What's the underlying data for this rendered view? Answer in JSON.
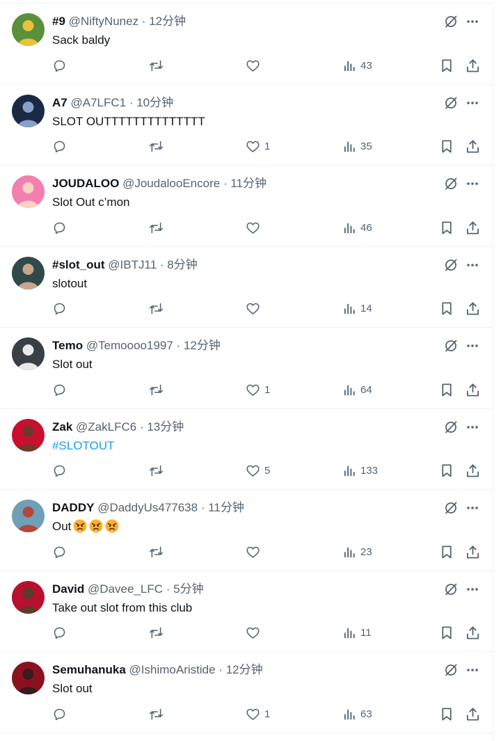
{
  "posts": [
    {
      "name": "#9",
      "handle": "@NiftyNunez",
      "time": "12分钟",
      "text": "Sack baldy",
      "likes": "",
      "views": "43",
      "avatar_colors": [
        "#5a8f3c",
        "#e8c23a"
      ]
    },
    {
      "name": "A7",
      "handle": "@A7LFC1",
      "time": "10分钟",
      "text": "SLOT OUTTTTTTTTTTTTTT",
      "likes": "1",
      "views": "35",
      "avatar_colors": [
        "#1b2a44",
        "#8aa0c8"
      ]
    },
    {
      "name": "JOUDALOO",
      "handle": "@JoudalooEncore",
      "time": "11分钟",
      "text": "Slot Out c’mon",
      "likes": "",
      "views": "46",
      "avatar_colors": [
        "#f27fb0",
        "#f6d3c0"
      ]
    },
    {
      "name": "#slot_out",
      "handle": "@IBTJ11",
      "time": "8分钟",
      "text": "slotout",
      "likes": "",
      "views": "14",
      "avatar_colors": [
        "#2f4a48",
        "#c9a58a"
      ]
    },
    {
      "name": "Temo",
      "handle": "@Temoooo1997",
      "time": "12分钟",
      "text": "Slot out",
      "likes": "1",
      "views": "64",
      "avatar_colors": [
        "#3a3f45",
        "#e8e8e8"
      ]
    },
    {
      "name": "Zak",
      "handle": "@ZakLFC6",
      "time": "13分钟",
      "text": "#SLOTOUT",
      "text_is_link": true,
      "likes": "5",
      "views": "133",
      "avatar_colors": [
        "#c8102e",
        "#6b3a2a"
      ]
    },
    {
      "name": "DADDY",
      "handle": "@DaddyUs477638",
      "time": "11分钟",
      "text": "Out",
      "emojis": [
        "angry-face",
        "angry-face",
        "angry-face"
      ],
      "likes": "",
      "views": "23",
      "avatar_colors": [
        "#6fa0b8",
        "#b3473a"
      ]
    },
    {
      "name": "David",
      "handle": "@Davee_LFC",
      "time": "5分钟",
      "text": "Take out slot from this club",
      "likes": "",
      "views": "11",
      "avatar_colors": [
        "#b8102e",
        "#5b3a2a"
      ]
    },
    {
      "name": "Semuhanuka",
      "handle": "@IshimoAristide",
      "time": "12分钟",
      "text": "Slot out",
      "likes": "1",
      "views": "63",
      "avatar_colors": [
        "#8a1220",
        "#3a1a1a"
      ]
    }
  ],
  "colors": {
    "text": "#0f1419",
    "secondary": "#536471",
    "link": "#1d9bf0",
    "divider": "#eff3f4"
  },
  "icons": {
    "reply": "reply-icon",
    "repost": "repost-icon",
    "like": "like-icon",
    "views": "views-icon",
    "bookmark": "bookmark-icon",
    "share": "share-icon",
    "grok": "grok-icon",
    "more": "more-icon"
  }
}
